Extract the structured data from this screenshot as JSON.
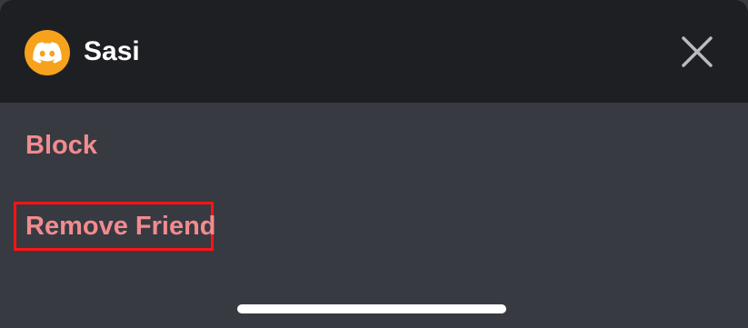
{
  "header": {
    "username": "Sasi",
    "avatar_color": "#f6a21c",
    "avatar_icon": "discord-logo-icon",
    "close_icon": "close-icon"
  },
  "menu": {
    "items": [
      {
        "label": "Block",
        "color": "#f28b8f"
      },
      {
        "label": "Remove Friend",
        "color": "#f28b8f",
        "highlighted": true
      }
    ]
  },
  "colors": {
    "header_bg": "#1e1f22",
    "sheet_bg": "#373a41",
    "highlight_border": "#ff1414"
  }
}
